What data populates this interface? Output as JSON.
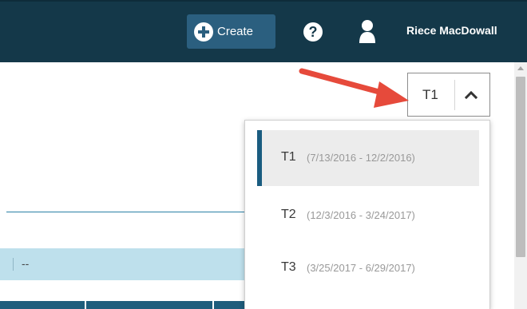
{
  "header": {
    "create_label": "Create",
    "help_symbol": "?",
    "user_name": "Riece MacDowall",
    "background_color": "#143849",
    "create_button_color": "#2b5f7f"
  },
  "term_select": {
    "selected": "T1",
    "options": [
      {
        "code": "T1",
        "range": "(7/13/2016 - 12/2/2016)",
        "selected": true
      },
      {
        "code": "T2",
        "range": "(12/3/2016 - 3/24/2017)",
        "selected": false
      },
      {
        "code": "T3",
        "range": "(3/25/2017 - 6/29/2017)",
        "selected": false
      }
    ]
  },
  "content": {
    "row_value": "--",
    "accent_color": "#2a80a6",
    "row_color": "#bee0ec"
  },
  "annotation": {
    "arrow_color": "#e64a3b"
  },
  "icons": [
    "plus-circle-icon",
    "help-icon",
    "user-icon",
    "chevron-up-icon",
    "scroll-up-arrow-icon"
  ]
}
